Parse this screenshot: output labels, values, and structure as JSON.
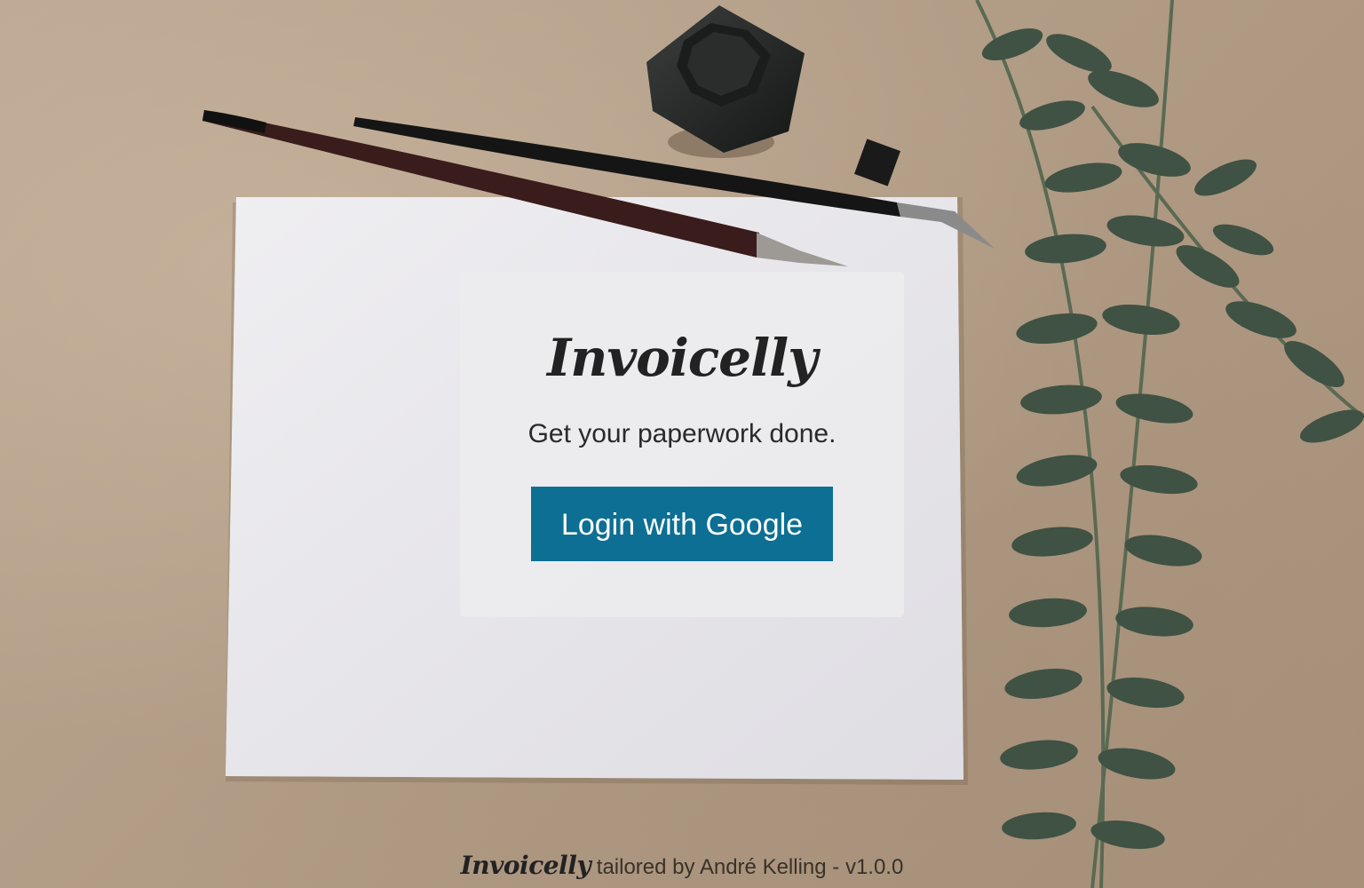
{
  "login_card": {
    "brand": "Invoicelly",
    "tagline": "Get your paperwork done.",
    "login_button": "Login with Google",
    "button_color": "#0c6f93"
  },
  "footer": {
    "brand": "Invoicelly",
    "credit": "tailored by André Kelling - v1.0.0"
  }
}
